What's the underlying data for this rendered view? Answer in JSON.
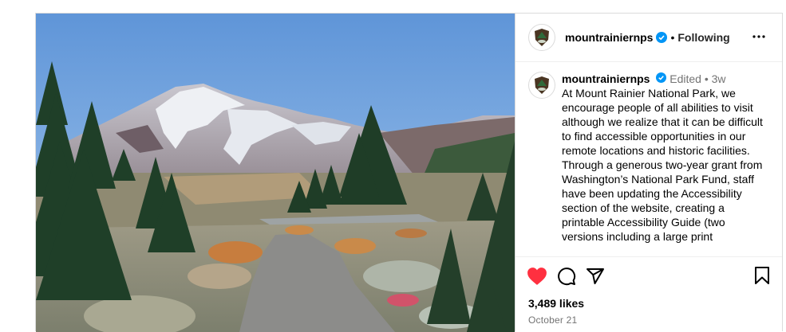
{
  "post": {
    "username": "mountrainiernps",
    "follow_status": "Following",
    "separator": "•",
    "caption": {
      "username": "mountrainiernps",
      "edited_label": "Edited",
      "age": "3w",
      "text": "At Mount Rainier National Park, we encourage people of all abilities to visit although we realize that it can be difficult to find accessible opportunities in our remote locations and historic facilities. Through a generous two-year grant from Washington’s National Park Fund, staff have been updating the Accessibility section of the website, creating a printable Accessibility Guide (two versions including a large print"
    },
    "likes": "3,489 likes",
    "date": "October 21",
    "icons": {
      "like": "heart-filled-icon",
      "comment": "comment-icon",
      "share": "share-icon",
      "save": "bookmark-icon",
      "more": "more-options-icon",
      "verified": "verified-badge-icon"
    },
    "colors": {
      "like_red": "#ff3040",
      "verified_blue": "#0095f6",
      "muted": "#737373"
    }
  }
}
